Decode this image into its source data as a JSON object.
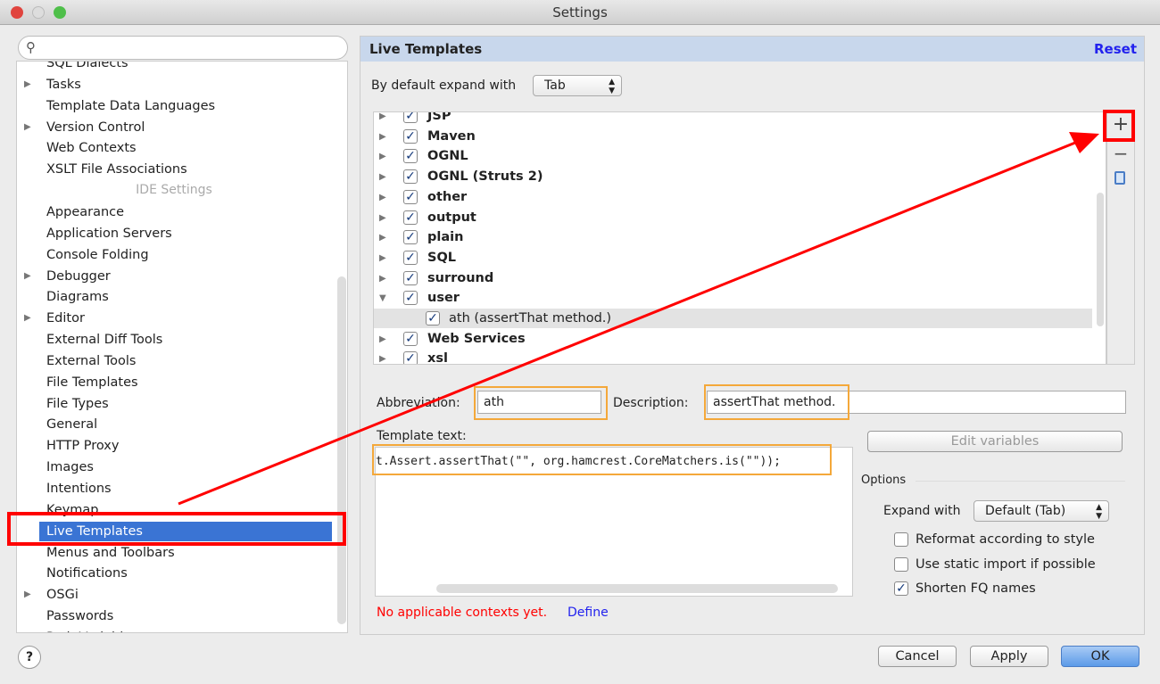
{
  "window": {
    "title": "Settings"
  },
  "left": {
    "search_placeholder": "",
    "items": [
      {
        "label": "SQL Dialects",
        "expandable": false
      },
      {
        "label": "Tasks",
        "expandable": true
      },
      {
        "label": "Template Data Languages",
        "expandable": false
      },
      {
        "label": "Version Control",
        "expandable": true
      },
      {
        "label": "Web Contexts",
        "expandable": false
      },
      {
        "label": "XSLT File Associations",
        "expandable": false
      },
      {
        "separator": "IDE Settings"
      },
      {
        "label": "Appearance",
        "expandable": false
      },
      {
        "label": "Application Servers",
        "expandable": false
      },
      {
        "label": "Console Folding",
        "expandable": false
      },
      {
        "label": "Debugger",
        "expandable": true
      },
      {
        "label": "Diagrams",
        "expandable": false
      },
      {
        "label": "Editor",
        "expandable": true
      },
      {
        "label": "External Diff Tools",
        "expandable": false
      },
      {
        "label": "External Tools",
        "expandable": false
      },
      {
        "label": "File Templates",
        "expandable": false
      },
      {
        "label": "File Types",
        "expandable": false
      },
      {
        "label": "General",
        "expandable": false
      },
      {
        "label": "HTTP Proxy",
        "expandable": false
      },
      {
        "label": "Images",
        "expandable": false
      },
      {
        "label": "Intentions",
        "expandable": false
      },
      {
        "label": "Keymap",
        "expandable": false
      },
      {
        "label": "Live Templates",
        "expandable": false,
        "selected": true
      },
      {
        "label": "Menus and Toolbars",
        "expandable": false
      },
      {
        "label": "Notifications",
        "expandable": false
      },
      {
        "label": "OSGi",
        "expandable": true
      },
      {
        "label": "Passwords",
        "expandable": false
      },
      {
        "label": "Path Variables",
        "expandable": false
      }
    ]
  },
  "right": {
    "title": "Live Templates",
    "reset": "Reset",
    "expand_label": "By default expand with",
    "expand_value": "Tab",
    "groups": [
      {
        "label": "JSP",
        "checked": true
      },
      {
        "label": "Maven",
        "checked": true
      },
      {
        "label": "OGNL",
        "checked": true
      },
      {
        "label": "OGNL (Struts 2)",
        "checked": true
      },
      {
        "label": "other",
        "checked": true
      },
      {
        "label": "output",
        "checked": true
      },
      {
        "label": "plain",
        "checked": true
      },
      {
        "label": "SQL",
        "checked": true
      },
      {
        "label": "surround",
        "checked": true
      },
      {
        "label": "user",
        "checked": true,
        "expanded": true
      },
      {
        "label": "ath (assertThat method.)",
        "checked": true,
        "child": true,
        "selected": true
      },
      {
        "label": "Web Services",
        "checked": true
      },
      {
        "label": "xsl",
        "checked": true
      }
    ],
    "toolbar": {
      "add": "+",
      "remove": "−"
    },
    "abbreviation_label": "Abbreviation:",
    "abbreviation": "ath",
    "description_label": "Description:",
    "description": "assertThat method.",
    "template_text_label": "Template text:",
    "template_text": "t.Assert.assertThat(\"\", org.hamcrest.CoreMatchers.is(\"\"));",
    "edit_variables": "Edit variables",
    "options_label": "Options",
    "expand_with_label": "Expand with",
    "expand_with_value": "Default (Tab)",
    "options": [
      {
        "label": "Reformat according to style",
        "checked": false
      },
      {
        "label": "Use static import if possible",
        "checked": false
      },
      {
        "label": "Shorten FQ names",
        "checked": true
      }
    ],
    "contexts_warning": "No applicable contexts yet.",
    "define": "Define"
  },
  "footer": {
    "help": "?",
    "cancel": "Cancel",
    "apply": "Apply",
    "ok": "OK"
  },
  "colors": {
    "selection": "#3a74d4",
    "highlight": "#ff0000",
    "field_highlight": "#f4a83a",
    "link": "#2222ee",
    "warning": "#ff0000"
  }
}
